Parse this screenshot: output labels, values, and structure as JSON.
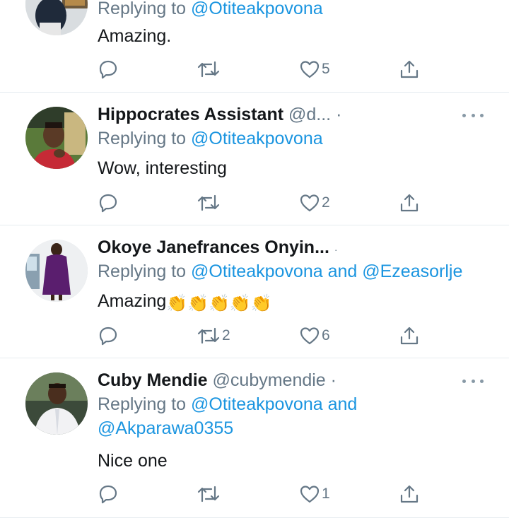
{
  "tweets": [
    {
      "name": "",
      "handle": "",
      "replying_prefix": "Replying to ",
      "mentions": [
        "@Otiteakpovona"
      ],
      "text": "Amazing.",
      "claps": "",
      "replies": "",
      "retweets": "",
      "likes": "5"
    },
    {
      "name": "Hippocrates Assistant",
      "handle": "@d...",
      "replying_prefix": "Replying to ",
      "mentions": [
        "@Otiteakpovona"
      ],
      "text": "Wow, interesting",
      "claps": "",
      "replies": "",
      "retweets": "",
      "likes": "2"
    },
    {
      "name": "Okoye Janefrances Onyin...",
      "handle": "",
      "replying_prefix": "Replying to ",
      "mentions": [
        "@Otiteakpovona",
        "@Ezeasorlje"
      ],
      "and_word": " and ",
      "text": "Amazing",
      "claps": "👏👏👏👏👏",
      "replies": "",
      "retweets": "2",
      "likes": "6"
    },
    {
      "name": "Cuby Mendie",
      "handle": "@cubymendie",
      "replying_prefix": "Replying to ",
      "mentions": [
        "@Otiteakpovona",
        "@Akparawa0355"
      ],
      "and_word": " and",
      "text": "Nice one",
      "claps": "",
      "replies": "",
      "retweets": "",
      "likes": "1"
    }
  ],
  "icons": {
    "reply": "reply-icon",
    "retweet": "retweet-icon",
    "like": "heart-icon",
    "share": "share-icon",
    "more": "more-icon"
  },
  "colors": {
    "link": "#1b95e0",
    "muted": "#657786",
    "divider": "#e6ecf0"
  }
}
